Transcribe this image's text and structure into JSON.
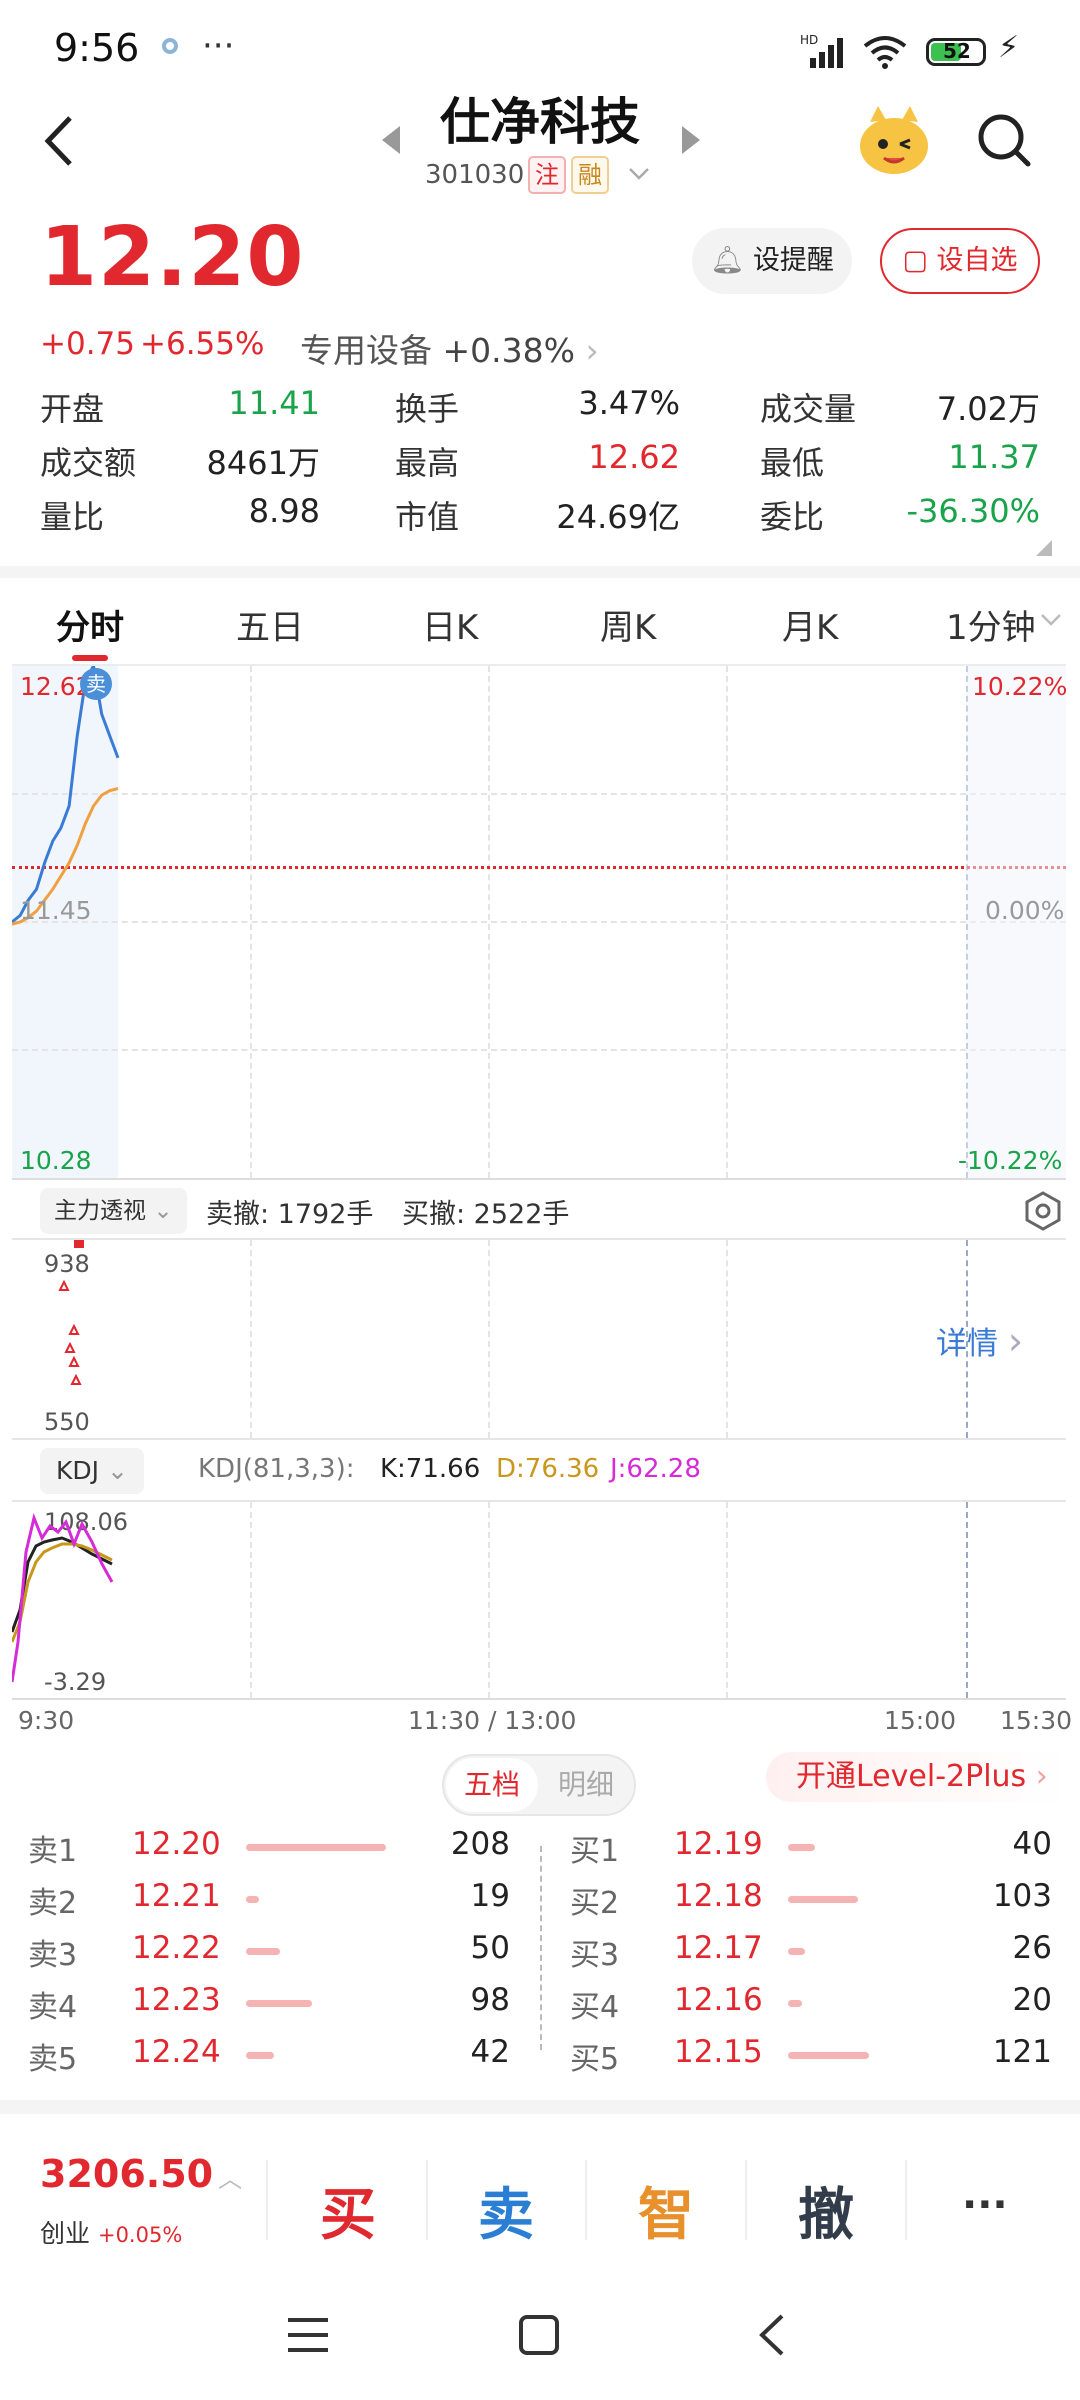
{
  "status": {
    "time": "9:56",
    "battery": "52"
  },
  "header": {
    "title": "仕净科技",
    "code": "301030",
    "tag1": "注",
    "tag2": "融"
  },
  "quote": {
    "price": "12.20",
    "change": "+0.75",
    "change_pct": "+6.55%",
    "sector": "专用设备",
    "sector_pct": "+0.38%",
    "remind_label": "设提醒",
    "watch_label": "设自选",
    "stats": [
      {
        "label": "开盘",
        "value": "11.41",
        "color": "green"
      },
      {
        "label": "换手",
        "value": "3.47%",
        "color": "black"
      },
      {
        "label": "成交量",
        "value": "7.02万",
        "color": "black"
      },
      {
        "label": "成交额",
        "value": "8461万",
        "color": "black"
      },
      {
        "label": "最高",
        "value": "12.62",
        "color": "red"
      },
      {
        "label": "最低",
        "value": "11.37",
        "color": "green"
      },
      {
        "label": "量比",
        "value": "8.98",
        "color": "black"
      },
      {
        "label": "市值",
        "value": "24.69亿",
        "color": "black"
      },
      {
        "label": "委比",
        "value": "-36.30%",
        "color": "green"
      }
    ]
  },
  "tabs": [
    "分时",
    "五日",
    "日K",
    "周K",
    "月K",
    "1分钟"
  ],
  "chart_labels": {
    "price_top": "12.62",
    "price_mid": "11.45",
    "price_bottom": "10.28",
    "pct_top": "10.22%",
    "pct_mid": "0.00%",
    "pct_bottom": "-10.22%",
    "sell_marker": "卖",
    "vol_top": "938",
    "vol_bottom": "550",
    "kdj_top": "108.06",
    "kdj_bottom": "-3.29",
    "time_start": "9:30",
    "time_mid": "11:30 / 13:00",
    "time_1500": "15:00",
    "time_end": "15:30"
  },
  "chart_data": {
    "type": "line",
    "title": "",
    "series": [
      {
        "x": [
          "09:30",
          "09:32",
          "09:34",
          "09:36",
          "09:38",
          "09:40",
          "09:42",
          "09:44",
          "09:46",
          "09:48",
          "09:50",
          "09:52",
          "09:54",
          "09:56"
        ],
        "values": [
          11.45,
          11.48,
          11.55,
          11.6,
          11.72,
          11.82,
          11.88,
          11.98,
          12.3,
          12.55,
          12.62,
          12.4,
          12.3,
          12.2
        ]
      },
      {
        "x": [
          "09:30",
          "09:32",
          "09:34",
          "09:36",
          "09:38",
          "09:40",
          "09:42",
          "09:44",
          "09:46",
          "09:48",
          "09:50",
          "09:52",
          "09:54",
          "09:56"
        ],
        "values": [
          11.44,
          11.45,
          11.47,
          11.5,
          11.55,
          11.6,
          11.66,
          11.72,
          11.8,
          11.9,
          11.98,
          12.03,
          12.05,
          12.06
        ]
      }
    ],
    "ylim": [
      10.28,
      12.62
    ],
    "colors": [
      "#3a7bd5",
      "#f0a040"
    ]
  },
  "sub1": {
    "selector": "主力透视",
    "sell_cancel": "卖撤: 1792手",
    "buy_cancel": "买撤: 2522手",
    "detail": "详情"
  },
  "kdj": {
    "selector": "KDJ",
    "params": "KDJ(81,3,3):",
    "k": "K:71.66",
    "d": "D:76.36",
    "j": "J:62.28"
  },
  "orderbook": {
    "tab_active": "五档",
    "tab_inactive": "明细",
    "promo": "开通Level-2Plus",
    "sells": [
      {
        "label": "卖1",
        "price": "12.20",
        "vol": "208",
        "ratio": 1.0
      },
      {
        "label": "卖2",
        "price": "12.21",
        "vol": "19",
        "ratio": 0.09
      },
      {
        "label": "卖3",
        "price": "12.22",
        "vol": "50",
        "ratio": 0.24
      },
      {
        "label": "卖4",
        "price": "12.23",
        "vol": "98",
        "ratio": 0.47
      },
      {
        "label": "卖5",
        "price": "12.24",
        "vol": "42",
        "ratio": 0.2
      }
    ],
    "buys": [
      {
        "label": "买1",
        "price": "12.19",
        "vol": "40",
        "ratio": 0.19
      },
      {
        "label": "买2",
        "price": "12.18",
        "vol": "103",
        "ratio": 0.5
      },
      {
        "label": "买3",
        "price": "12.17",
        "vol": "26",
        "ratio": 0.12
      },
      {
        "label": "买4",
        "price": "12.16",
        "vol": "20",
        "ratio": 0.1
      },
      {
        "label": "买5",
        "price": "12.15",
        "vol": "121",
        "ratio": 0.58
      }
    ]
  },
  "bottom": {
    "index_value": "3206.50",
    "index_name": "创业",
    "index_pct": "+0.05%",
    "buy": "买",
    "sell": "卖",
    "smart": "智",
    "cancel": "撤",
    "more": "···"
  }
}
